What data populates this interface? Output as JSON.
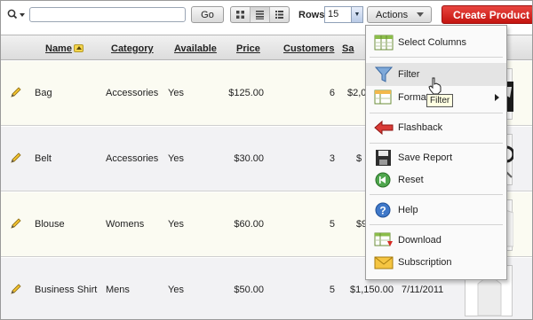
{
  "toolbar": {
    "search_placeholder": "",
    "go_label": "Go",
    "rows_label": "Rows",
    "rows_value": "15",
    "actions_label": "Actions",
    "create_label": "Create Product >"
  },
  "table": {
    "headers": {
      "name": "Name",
      "category": "Category",
      "available": "Available",
      "price": "Price",
      "customers": "Customers",
      "sales": "Sa"
    },
    "rows": [
      {
        "name": "Bag",
        "category": "Accessories",
        "available": "Yes",
        "price": "$125.00",
        "customers": "6",
        "sales": "$2,0",
        "date": ""
      },
      {
        "name": "Belt",
        "category": "Accessories",
        "available": "Yes",
        "price": "$30.00",
        "customers": "3",
        "sales": "$",
        "date": ""
      },
      {
        "name": "Blouse",
        "category": "Womens",
        "available": "Yes",
        "price": "$60.00",
        "customers": "5",
        "sales": "$9",
        "date": ""
      },
      {
        "name": "Business Shirt",
        "category": "Mens",
        "available": "Yes",
        "price": "$50.00",
        "customers": "5",
        "sales": "$1,150.00",
        "date": "7/11/2011"
      }
    ]
  },
  "actions_menu": {
    "items": [
      {
        "label": "Select Columns",
        "icon": "select-columns-icon"
      },
      {
        "label": "Filter",
        "icon": "filter-icon"
      },
      {
        "label": "Format",
        "icon": "format-icon"
      },
      {
        "label": "Flashback",
        "icon": "flashback-icon"
      },
      {
        "label": "Save Report",
        "icon": "save-icon"
      },
      {
        "label": "Reset",
        "icon": "reset-icon"
      },
      {
        "label": "Help",
        "icon": "help-icon"
      },
      {
        "label": "Download",
        "icon": "download-icon"
      },
      {
        "label": "Subscription",
        "icon": "subscription-icon"
      }
    ],
    "tooltip": "Filter"
  }
}
